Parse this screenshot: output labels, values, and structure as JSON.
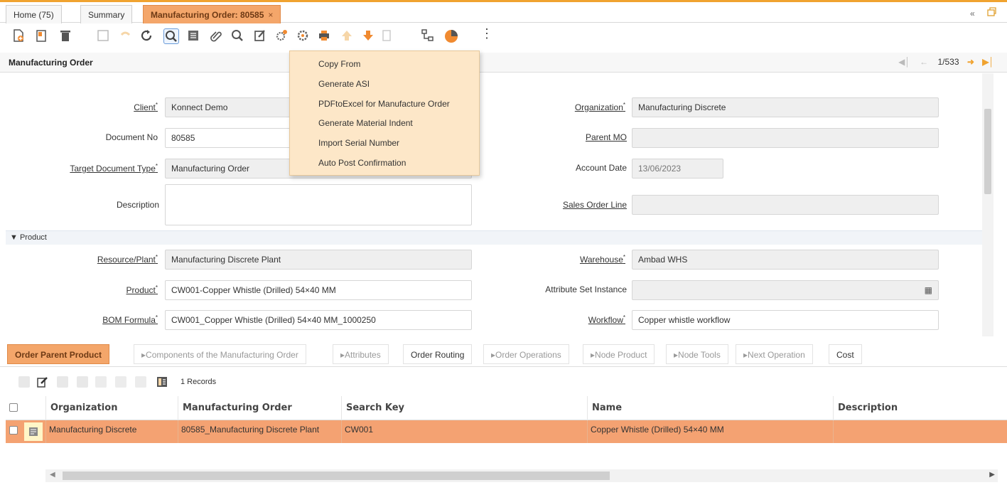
{
  "tabs": [
    {
      "label": "Home (75)"
    },
    {
      "label": "Summary"
    },
    {
      "label": "Manufacturing Order: 80585",
      "close": "×"
    }
  ],
  "tabbar_right": {
    "collapse": "«",
    "icon": "user-icon"
  },
  "header": {
    "title": "Manufacturing Order",
    "record_nav": "1/533"
  },
  "menu": {
    "items": [
      "Copy From",
      "Generate ASI",
      "PDFtoExcel for Manufacture Order",
      "Generate Material Indent",
      "Import Serial Number",
      "Auto Post Confirmation"
    ]
  },
  "form": {
    "client": {
      "label": "Client",
      "value": "Konnect Demo"
    },
    "document_no": {
      "label": "Document No",
      "value": "80585"
    },
    "target_doc_type": {
      "label": "Target Document Type",
      "value": "Manufacturing Order"
    },
    "description": {
      "label": "Description",
      "value": ""
    },
    "organization": {
      "label": "Organization",
      "value": "Manufacturing Discrete"
    },
    "parent_mo": {
      "label": "Parent MO",
      "value": ""
    },
    "account_date": {
      "label": "Account Date",
      "value": "13/06/2023"
    },
    "sales_order_line": {
      "label": "Sales Order Line",
      "value": ""
    },
    "product_section": "Product",
    "resource_plant": {
      "label": "Resource/Plant",
      "value": "Manufacturing Discrete Plant"
    },
    "product": {
      "label": "Product",
      "value": "CW001-Copper Whistle (Drilled) 54×40 MM"
    },
    "bom_formula": {
      "label": "BOM Formula",
      "value": "CW001_Copper Whistle (Drilled) 54×40 MM_1000250"
    },
    "warehouse": {
      "label": "Warehouse",
      "value": "Ambad WHS"
    },
    "attribute_set_instance": {
      "label": "Attribute Set Instance",
      "value": ""
    },
    "workflow": {
      "label": "Workflow",
      "value": "Copper whistle workflow"
    }
  },
  "detail_tabs": [
    {
      "label": "Order Parent Product",
      "state": "active"
    },
    {
      "label": "Components of the Manufacturing Order",
      "state": "disabled"
    },
    {
      "label": "Attributes",
      "state": "disabled"
    },
    {
      "label": "Order Routing",
      "state": "enabled"
    },
    {
      "label": "Order Operations",
      "state": "disabled"
    },
    {
      "label": "Node Product",
      "state": "disabled"
    },
    {
      "label": "Node Tools",
      "state": "disabled"
    },
    {
      "label": "Next Operation",
      "state": "disabled"
    },
    {
      "label": "Cost",
      "state": "enabled"
    }
  ],
  "grid": {
    "records": "1 Records",
    "columns": [
      "Organization",
      "Manufacturing Order",
      "Search Key",
      "Name",
      "Description"
    ],
    "rows": [
      [
        "Manufacturing Discrete",
        "80585_Manufacturing Discrete Plant",
        "CW001",
        "Copper Whistle (Drilled) 54×40 MM",
        ""
      ]
    ]
  },
  "colors": {
    "accent": "#f4a66a",
    "selected_row": "#f4a272",
    "menu_bg": "#fde7c8"
  }
}
